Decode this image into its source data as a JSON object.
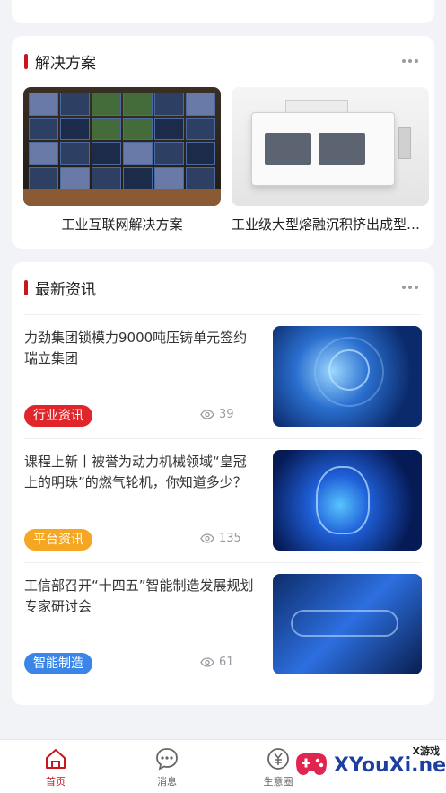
{
  "solutions": {
    "title": "解决方案",
    "items": [
      {
        "label": "工业互联网解决方案"
      },
      {
        "label": "工业级大型熔融沉积挤出成型设备"
      }
    ]
  },
  "news": {
    "title": "最新资讯",
    "items": [
      {
        "title": "力劲集团锁模力9000吨压铸单元签约瑞立集团",
        "tag": "行业资讯",
        "tag_color": "#e0252b",
        "views": "39"
      },
      {
        "title": "课程上新丨被誉为动力机械领域“皇冠上的明珠”的燃气轮机，你知道多少？",
        "tag": "平台资讯",
        "tag_color": "#f5a623",
        "views": "135"
      },
      {
        "title": "工信部召开“十四五”智能制造发展规划专家研讨会",
        "tag": "智能制造",
        "tag_color": "#3a86e8",
        "views": "61"
      }
    ]
  },
  "tabbar": {
    "items": [
      {
        "label": "首页",
        "icon": "home-icon",
        "active": true
      },
      {
        "label": "消息",
        "icon": "chat-icon",
        "active": false
      },
      {
        "label": "生意圈",
        "icon": "business-circle-icon",
        "active": false
      }
    ]
  },
  "watermark": {
    "main": "XYouXi.net",
    "small": "X游戏"
  },
  "colors": {
    "accent": "#c8161d",
    "background": "#f2f3f7"
  }
}
